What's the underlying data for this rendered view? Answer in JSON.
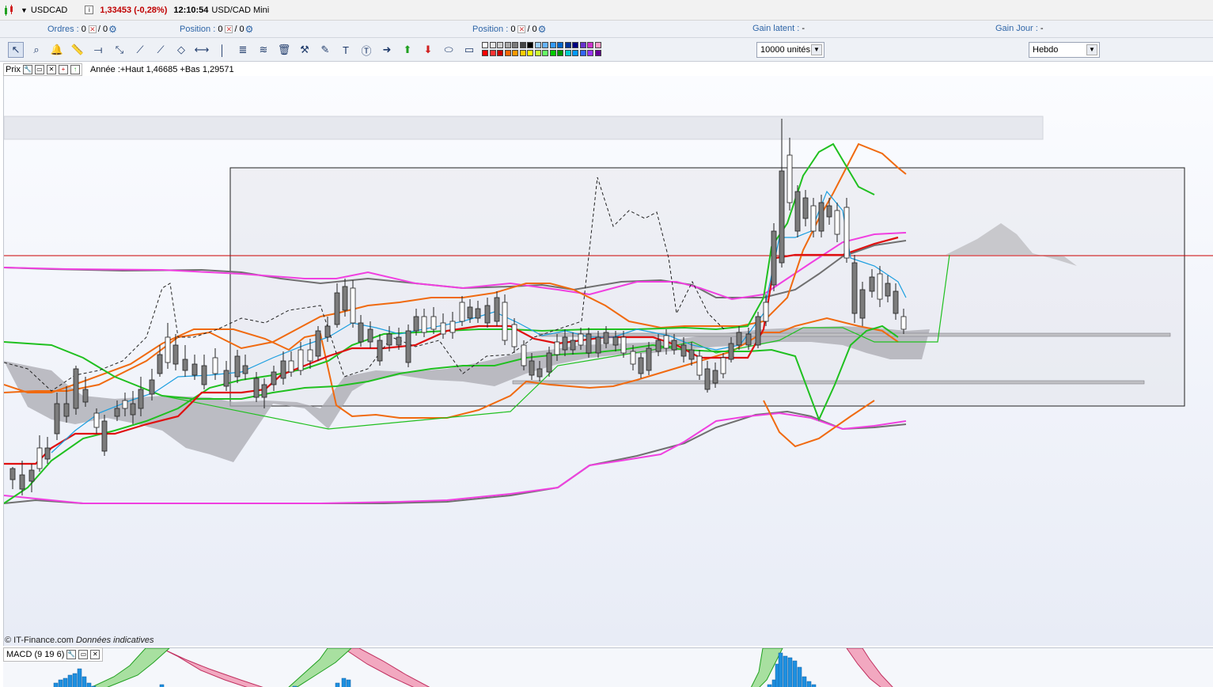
{
  "title_bar": {
    "symbol": "USDCAD",
    "price_change": "1,33453 (-0,28%)",
    "time": "12:10:54",
    "instrument": "USD/CAD Mini",
    "info_label": "i"
  },
  "position_bar": {
    "orders_label": "Ordres :",
    "orders_value": "0",
    "orders_total": "/ 0",
    "position1_label": "Position :",
    "position1_value": "0",
    "position1_total": "/ 0",
    "position2_label": "Position :",
    "position2_value": "0",
    "position2_total": "/ 0",
    "gain_latent_label": "Gain latent :",
    "gain_latent_value": "-",
    "gain_jour_label": "Gain Jour :",
    "gain_jour_value": "-"
  },
  "toolbar": {
    "tools": [
      "cursor-icon",
      "zoom-icon",
      "alert-bell-icon",
      "ruler-icon",
      "horizontal-line-icon",
      "diagonal-arrows-icon",
      "trend-line-icon",
      "extended-line-icon",
      "channel-icon",
      "horizontal-segment-icon",
      "vertical-line-icon",
      "fibonacci-icon",
      "fibonacci-fan-icon",
      "trash-icon",
      "tools-icon",
      "pen-icon",
      "text-box-icon",
      "speech-bubble-icon",
      "arrow-right-icon",
      "arrow-up-icon",
      "arrow-down-icon",
      "ellipse-icon",
      "rectangle-icon"
    ],
    "quantity": "10000 unités",
    "period": "Hebdo",
    "palette_colors": [
      "#ffffff",
      "#e8e8e8",
      "#cfcfcf",
      "#a8a8a8",
      "#7a7a7a",
      "#444444",
      "#000000",
      "#99ccff",
      "#66b3ff",
      "#3399ff",
      "#0066cc",
      "#003399",
      "#000080",
      "#6633cc",
      "#cc33cc",
      "#ff99cc",
      "#ff0000",
      "#ff3333",
      "#cc0000",
      "#ff6600",
      "#ff9900",
      "#ffcc00",
      "#ffff00",
      "#ccff33",
      "#66ff66",
      "#00cc00",
      "#009900",
      "#00cccc",
      "#0099ff",
      "#3366ff",
      "#9933ff",
      "#660099"
    ]
  },
  "chart_head": {
    "label": "Prix",
    "annee_text": "Année :+Haut 1,46685 +Bas 1,29571"
  },
  "footer": {
    "copyright": "© IT-Finance.com",
    "note": "Données indicatives"
  },
  "macd": {
    "label": "MACD (9 19 6)"
  },
  "colors": {
    "kijun": "#e01010",
    "tenkan": "#1c9fe0",
    "bollinger_orange": "#f06a10",
    "bollinger_green": "#20c020",
    "envelope_magenta": "#f040e0",
    "envelope_gray": "#707070",
    "chikou": "#222222",
    "cloud": "#9a9aa0",
    "resistance_line": "#cc0000"
  }
}
